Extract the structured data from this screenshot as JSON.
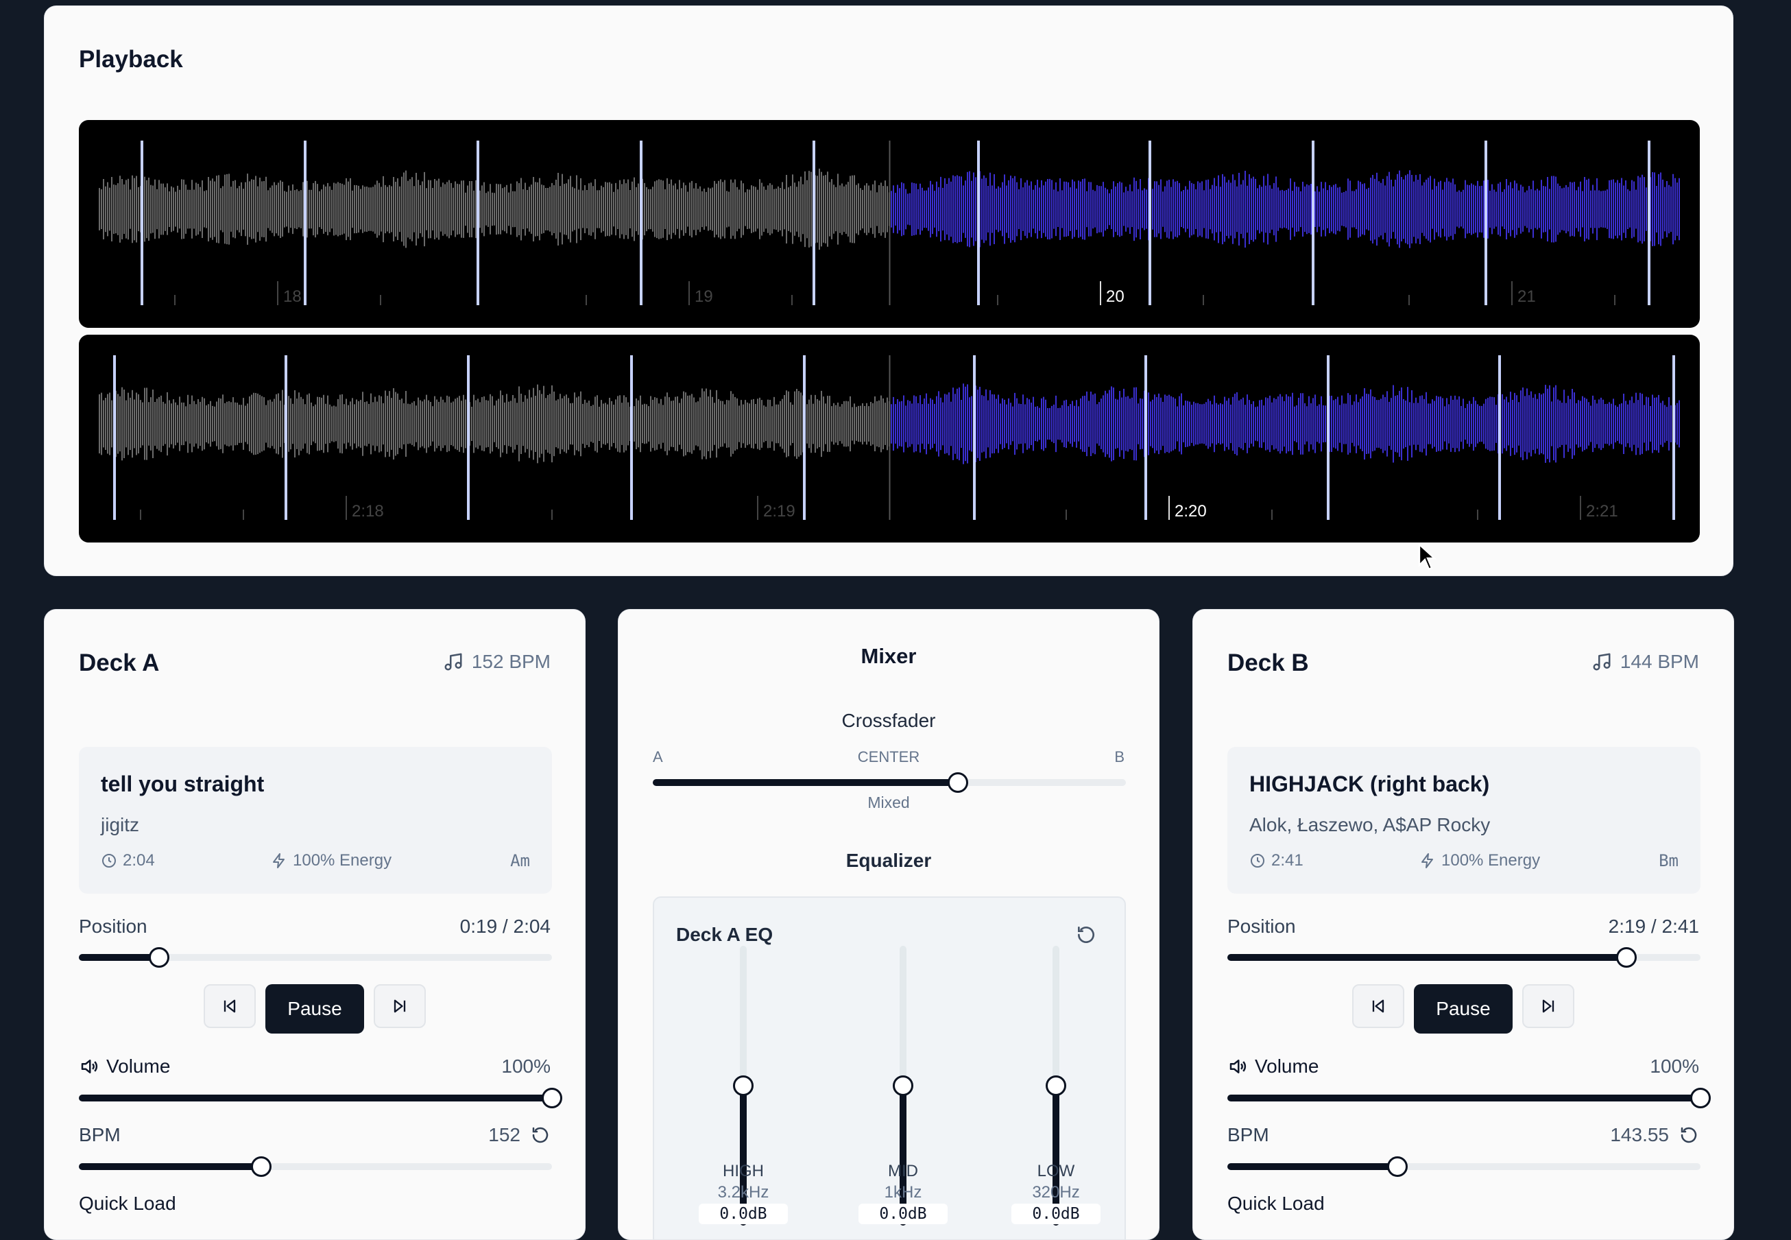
{
  "playback": {
    "title": "Playback",
    "wave_a": {
      "ticks": [
        "18",
        "19",
        "20",
        "21"
      ],
      "colors": {
        "played": "#6b6b6b",
        "remaining": "#3b2fd0",
        "beat": "#c7d2fe"
      }
    },
    "wave_b": {
      "ticks": [
        "2:18",
        "2:19",
        "2:20",
        "2:21"
      ]
    }
  },
  "deck_a": {
    "title": "Deck A",
    "bpm_badge": "152 BPM",
    "track": {
      "title": "tell you straight",
      "artist": "jigitz",
      "duration": "2:04",
      "energy": "100% Energy",
      "key": "Am"
    },
    "position_label": "Position",
    "position_value": "0:19 / 2:04",
    "position_level": 0.17,
    "prev_label": "",
    "pause_label": "Pause",
    "volume_label": "Volume",
    "volume_value": "100%",
    "volume_level": 1.0,
    "bpm_label": "BPM",
    "bpm_value": "152",
    "bpm_level": 0.385,
    "quick_load_label": "Quick Load"
  },
  "mixer": {
    "title": "Mixer",
    "crossfader_label": "Crossfader",
    "left": "A",
    "center": "CENTER",
    "right": "B",
    "crossfader_level": 0.645,
    "mode": "Mixed",
    "eq_title": "Equalizer",
    "eq_box_title": "Deck A EQ",
    "bands": [
      {
        "name": "HIGH",
        "freq": "3.2kHz",
        "value": "0.0dB",
        "level": 0.5
      },
      {
        "name": "MID",
        "freq": "1kHz",
        "value": "0.0dB",
        "level": 0.5
      },
      {
        "name": "LOW",
        "freq": "320Hz",
        "value": "0.0dB",
        "level": 0.5
      }
    ]
  },
  "deck_b": {
    "title": "Deck B",
    "bpm_badge": "144 BPM",
    "track": {
      "title": "HIGHJACK (right back)",
      "artist": "Alok, Łaszewo, A$AP Rocky",
      "duration": "2:41",
      "energy": "100% Energy",
      "key": "Bm"
    },
    "position_label": "Position",
    "position_value": "2:19 / 2:41",
    "position_level": 0.843,
    "pause_label": "Pause",
    "volume_label": "Volume",
    "volume_value": "100%",
    "volume_level": 1.0,
    "bpm_label": "BPM",
    "bpm_value": "143.55",
    "bpm_level": 0.36,
    "quick_load_label": "Quick Load"
  }
}
